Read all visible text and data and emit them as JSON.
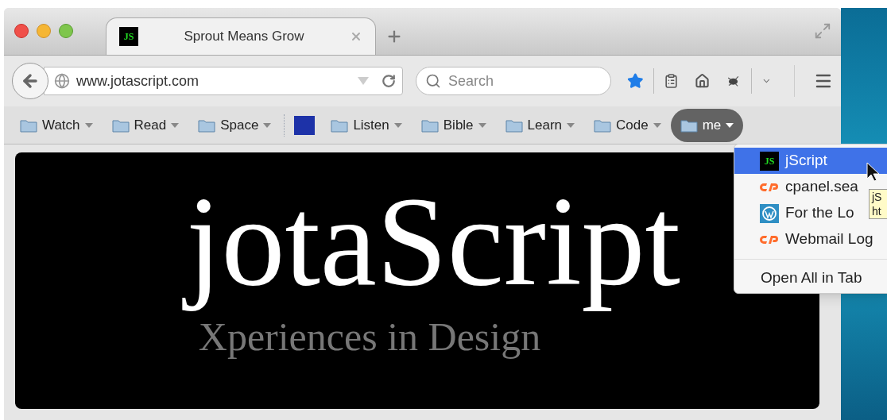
{
  "window": {
    "tabs": [
      {
        "title": "Sprout Means Grow",
        "favicon": "JS",
        "selected": true
      }
    ]
  },
  "toolbar": {
    "url": "www.jotascript.com",
    "search": {
      "placeholder": "Search"
    },
    "bookmarked": true
  },
  "bookmarks": [
    {
      "kind": "folder",
      "label": "Watch",
      "open": false
    },
    {
      "kind": "folder",
      "label": "Read",
      "open": false
    },
    {
      "kind": "folder",
      "label": "Space",
      "open": false
    },
    {
      "kind": "separator"
    },
    {
      "kind": "site"
    },
    {
      "kind": "folder",
      "label": "Listen",
      "open": false
    },
    {
      "kind": "folder",
      "label": "Bible",
      "open": false
    },
    {
      "kind": "folder",
      "label": "Learn",
      "open": false
    },
    {
      "kind": "folder",
      "label": "Code",
      "open": false
    },
    {
      "kind": "folder",
      "label": "me",
      "open": true
    }
  ],
  "menu": {
    "items": [
      {
        "kind": "js",
        "icon_text": "JS",
        "label": "jScript",
        "selected": true
      },
      {
        "kind": "cpanel",
        "label": "cpanel.sea",
        "selected": false
      },
      {
        "kind": "wordpress",
        "label": "For the Lo",
        "selected": false
      },
      {
        "kind": "cpanel",
        "label": "Webmail Log",
        "selected": false
      }
    ],
    "footer": "Open All in Tab"
  },
  "tooltip": {
    "lines": [
      "jS",
      "ht"
    ]
  },
  "banner": {
    "title": "jotaScript",
    "subtitle": "Xperiences in Design"
  }
}
